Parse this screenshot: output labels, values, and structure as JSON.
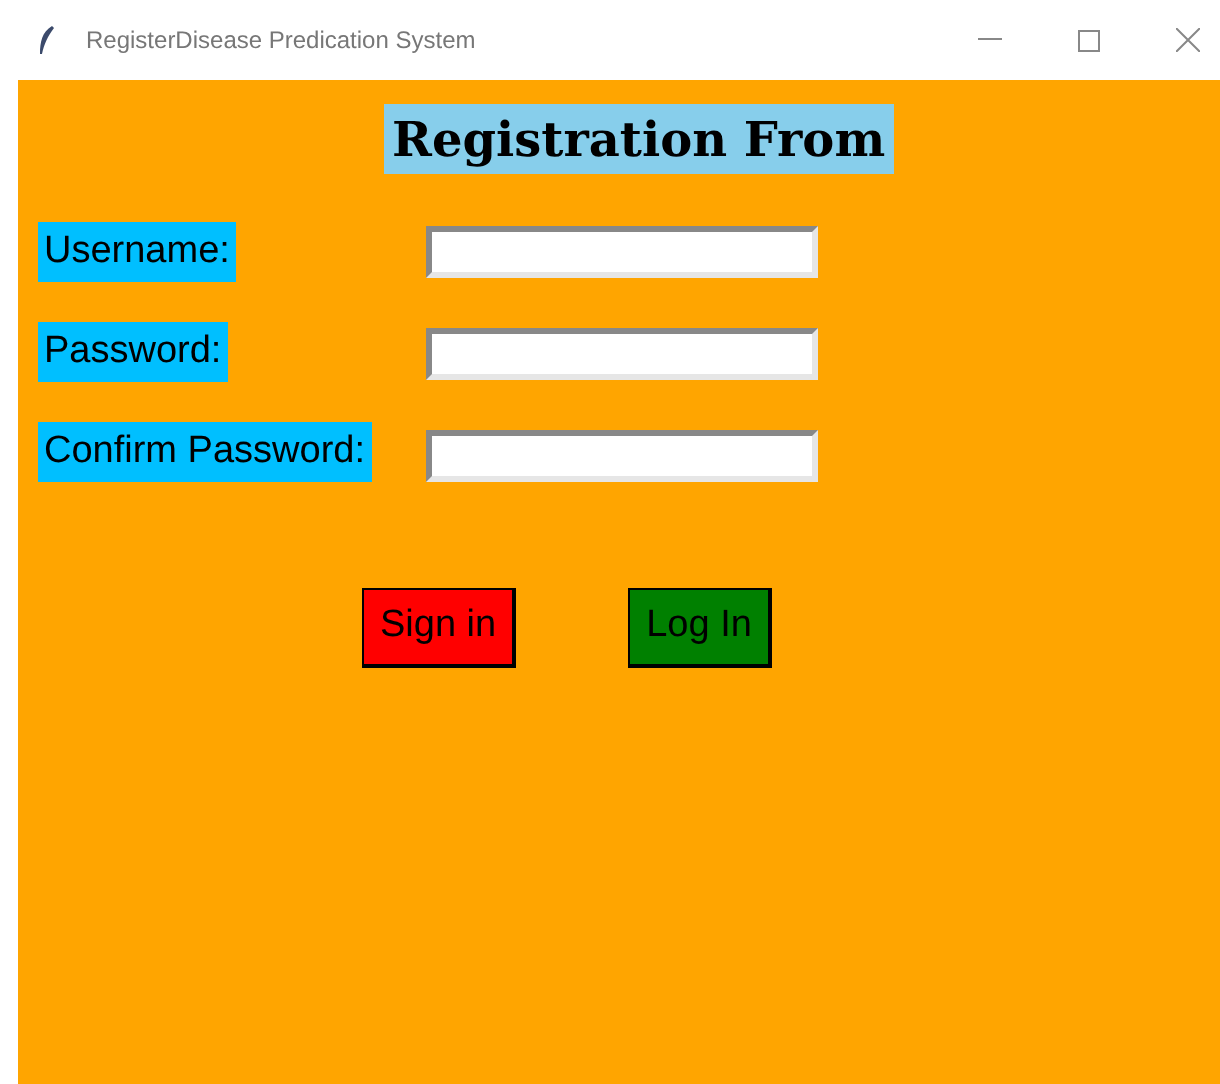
{
  "window": {
    "title": "RegisterDisease Predication System"
  },
  "heading": "Registration From",
  "fields": [
    {
      "label": "Username:"
    },
    {
      "label": "Password:"
    },
    {
      "label": "Confirm Password:"
    }
  ],
  "buttons": [
    {
      "label": "Sign in",
      "color": "#ff0000"
    },
    {
      "label": "Log In",
      "color": "#008000"
    }
  ]
}
